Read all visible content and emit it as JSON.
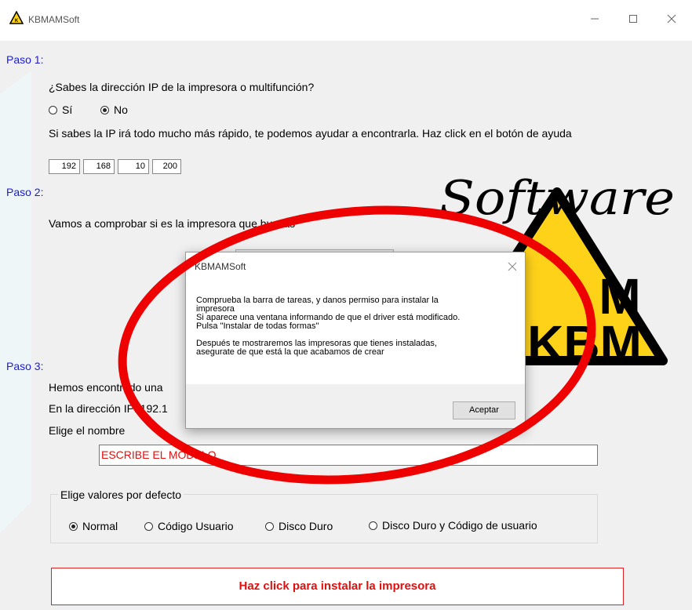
{
  "window": {
    "title": "KBMAMSoft",
    "minimize_icon": "minimize-icon",
    "maximize_icon": "maximize-icon",
    "close_icon": "close-icon"
  },
  "logo": {
    "text": "Software",
    "badge_top": "M",
    "badge_bottom": "KBM",
    "colors": {
      "yellow": "#ffd21a",
      "outline": "#000000"
    }
  },
  "step1": {
    "label": "Paso 1:",
    "question": "¿Sabes la dirección IP de la impresora o multifunción?",
    "option_yes": "Sí",
    "option_no": "No",
    "selected": "No",
    "hint": "Si sabes la IP irá todo mucho más rápido, te podemos ayudar a encontrarla. Haz click en el botón de ayuda",
    "ip": [
      "192",
      "168",
      "10",
      "200"
    ]
  },
  "step2": {
    "label": "Paso 2:",
    "text": "Vamos a comprobar si es la impresora que buscas"
  },
  "step3": {
    "label": "Paso 3:",
    "found": "Hemos encontrado una",
    "ip_label": "En la dirección IP: 192.1",
    "name_label": "Elige el nombre",
    "model_value": "ESCRIBE EL MODELO",
    "defaults_legend": "Elige valores por defecto",
    "options": [
      "Normal",
      "Código Usuario",
      "Disco Duro",
      "Disco Duro y Código de usuario"
    ],
    "selected": "Normal"
  },
  "install_button": "Haz click para instalar la impresora",
  "dialog": {
    "title": "KBMAMSoft",
    "message": [
      "Comprueba la barra de tareas, y danos permiso para instalar la\nimpresora\nSi aparece una ventana informando de que el driver está modificado.\nPulsa \"Instalar de todas formas\"",
      "Después te mostraremos las impresoras que tienes instaladas,\nasegurate de que está la que acabamos de crear"
    ],
    "ok": "Aceptar"
  },
  "annotation": {
    "shape": "ellipse",
    "color": "#ee0000"
  }
}
